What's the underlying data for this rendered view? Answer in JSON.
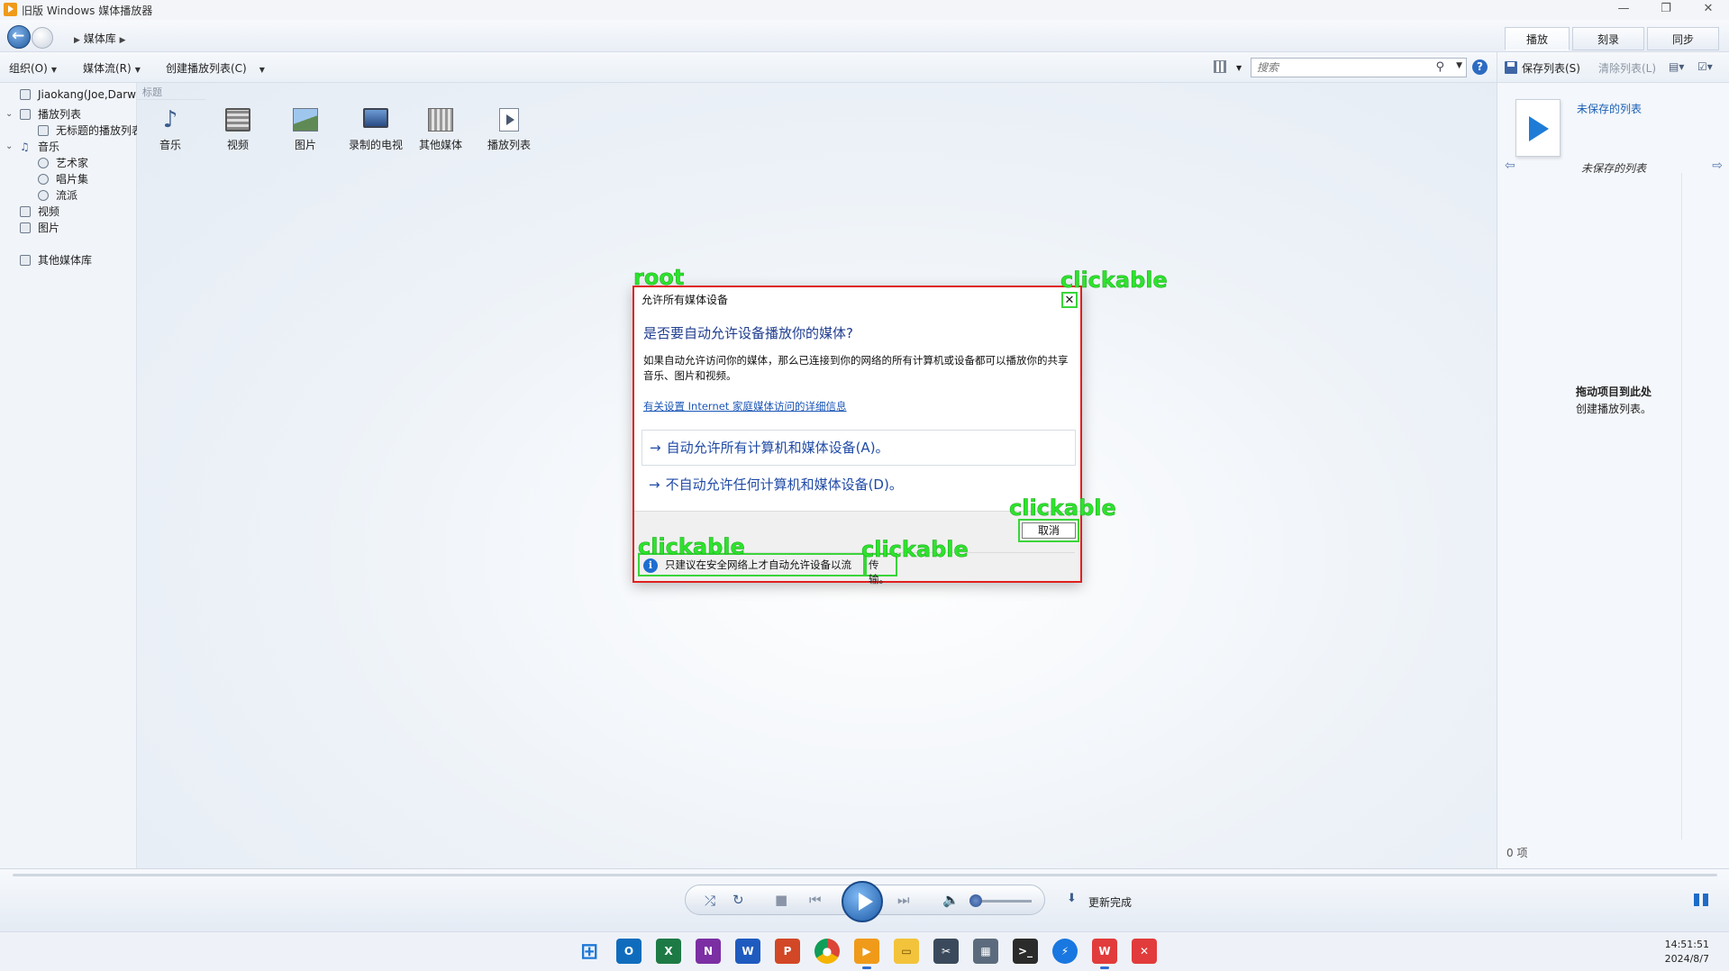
{
  "window": {
    "title": "旧版 Windows 媒体播放器",
    "min": "—",
    "max": "❐",
    "close": "✕"
  },
  "nav": {
    "breadcrumb": "媒体库"
  },
  "top_tabs": [
    "播放",
    "刻录",
    "同步"
  ],
  "toolbar": {
    "organize": "组织(O)",
    "stream": "媒体流(R)",
    "create_playlist": "创建播放列表(C)",
    "search_placeholder": "搜索"
  },
  "right_toolbar": {
    "save_list": "保存列表(S)",
    "clear_list": "清除列表(L)"
  },
  "sidebar": {
    "user": "Jiaokang(Joe,Darw",
    "playlists": "播放列表",
    "untitled_playlist": "无标题的播放列表",
    "music": "音乐",
    "artist": "艺术家",
    "album": "唱片集",
    "genre": "流派",
    "video": "视频",
    "pictures": "图片",
    "other_libraries": "其他媒体库"
  },
  "content": {
    "column_header": "标题",
    "tiles": [
      "音乐",
      "视频",
      "图片",
      "录制的电视",
      "其他媒体",
      "播放列表"
    ]
  },
  "right_pane": {
    "unsaved_link": "未保存的列表",
    "list_title": "未保存的列表",
    "drag_hint_bold": "拖动项目到此处",
    "drag_hint": "创建播放列表。",
    "count": "0 项"
  },
  "player": {
    "status": "更新完成"
  },
  "dialog": {
    "title": "允许所有媒体设备",
    "heading": "是否要自动允许设备播放你的媒体?",
    "description": "如果自动允许访问你的媒体，那么已连接到你的网络的所有计算机或设备都可以播放你的共享音乐、图片和视频。",
    "link": "有关设置 Internet 家庭媒体访问的详细信息",
    "option_allow": "自动允许所有计算机和媒体设备(A)。",
    "option_deny": "不自动允许任何计算机和媒体设备(D)。",
    "cancel": "取消",
    "info_text": "只建议在安全网络上才自动允许设备以流",
    "info_text_end": "传输。"
  },
  "annotations": {
    "root": "root",
    "clickable": "clickable"
  },
  "taskbar": {
    "apps": [
      "windows-start",
      "outlook",
      "excel",
      "onenote",
      "word",
      "powerpoint",
      "chrome",
      "media-player",
      "file-explorer",
      "snipping-tool",
      "calculator",
      "terminal",
      "quick-assist",
      "wps",
      "xmind"
    ],
    "time": "14:51:51",
    "date": "2024/8/7"
  }
}
